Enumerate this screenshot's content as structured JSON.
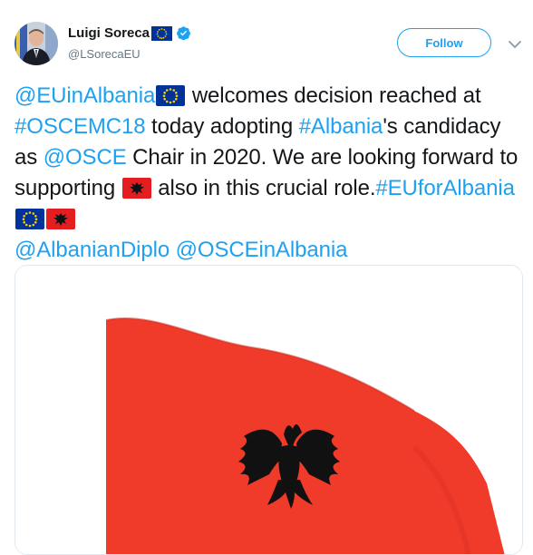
{
  "author": {
    "name": "Luigi Soreca",
    "handle": "@LSorecaEU"
  },
  "actions": {
    "follow_label": "Follow"
  },
  "tweet": {
    "mention_eu_albania": "@EUinAlbania",
    "text_welcomes": " welcomes decision reached at ",
    "hashtag_oscemc18": "#OSCEMC18",
    "text_today": " today adopting ",
    "hashtag_albania": "#Albania",
    "text_candidacy": "'s candidacy as ",
    "mention_osce": "@OSCE",
    "text_chair": " Chair in 2020. We are looking forward to supporting ",
    "text_also": " also in this crucial role.",
    "hashtag_euforalbania": "#EUforAlbania",
    "mention_albanian_diplo": "@AlbanianDiplo",
    "mention_osce_in_albania": "@OSCEinAlbania"
  },
  "colors": {
    "link": "#1da1f2",
    "text": "#14171a",
    "flag_red": "#f03a2a",
    "eagle": "#111111",
    "eu_blue": "#003399",
    "eu_star": "#ffcc00"
  },
  "icons": [
    "eu-flag-icon",
    "verified-badge-icon",
    "chevron-down-icon",
    "albania-flag-icon"
  ]
}
